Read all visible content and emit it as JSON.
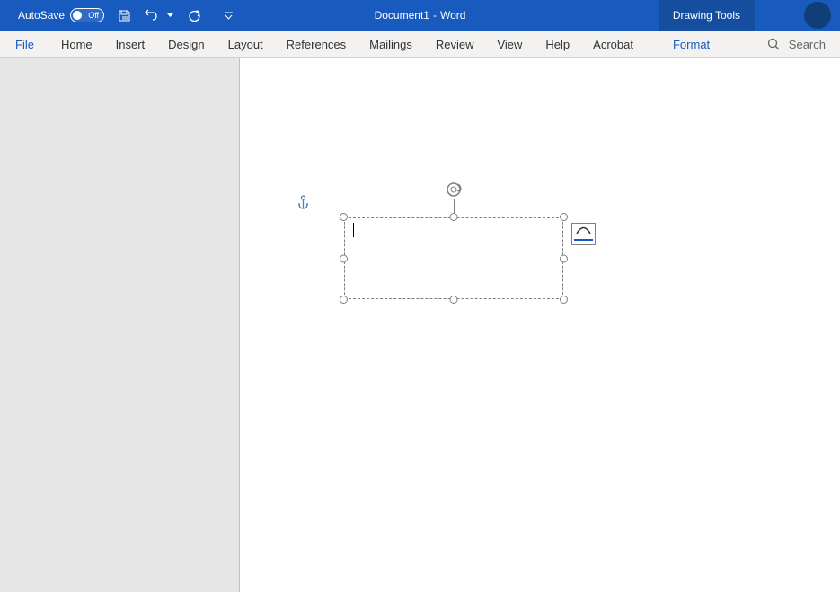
{
  "titleBar": {
    "autosave": "AutoSave",
    "toggleState": "Off",
    "docName": "Document1",
    "separator": "-",
    "appName": "Word",
    "drawingTools": "Drawing Tools"
  },
  "ribbon": {
    "tabs": {
      "file": "File",
      "home": "Home",
      "insert": "Insert",
      "design": "Design",
      "layout": "Layout",
      "references": "References",
      "mailings": "Mailings",
      "review": "Review",
      "view": "View",
      "help": "Help",
      "acrobat": "Acrobat",
      "format": "Format"
    },
    "search": "Search"
  }
}
